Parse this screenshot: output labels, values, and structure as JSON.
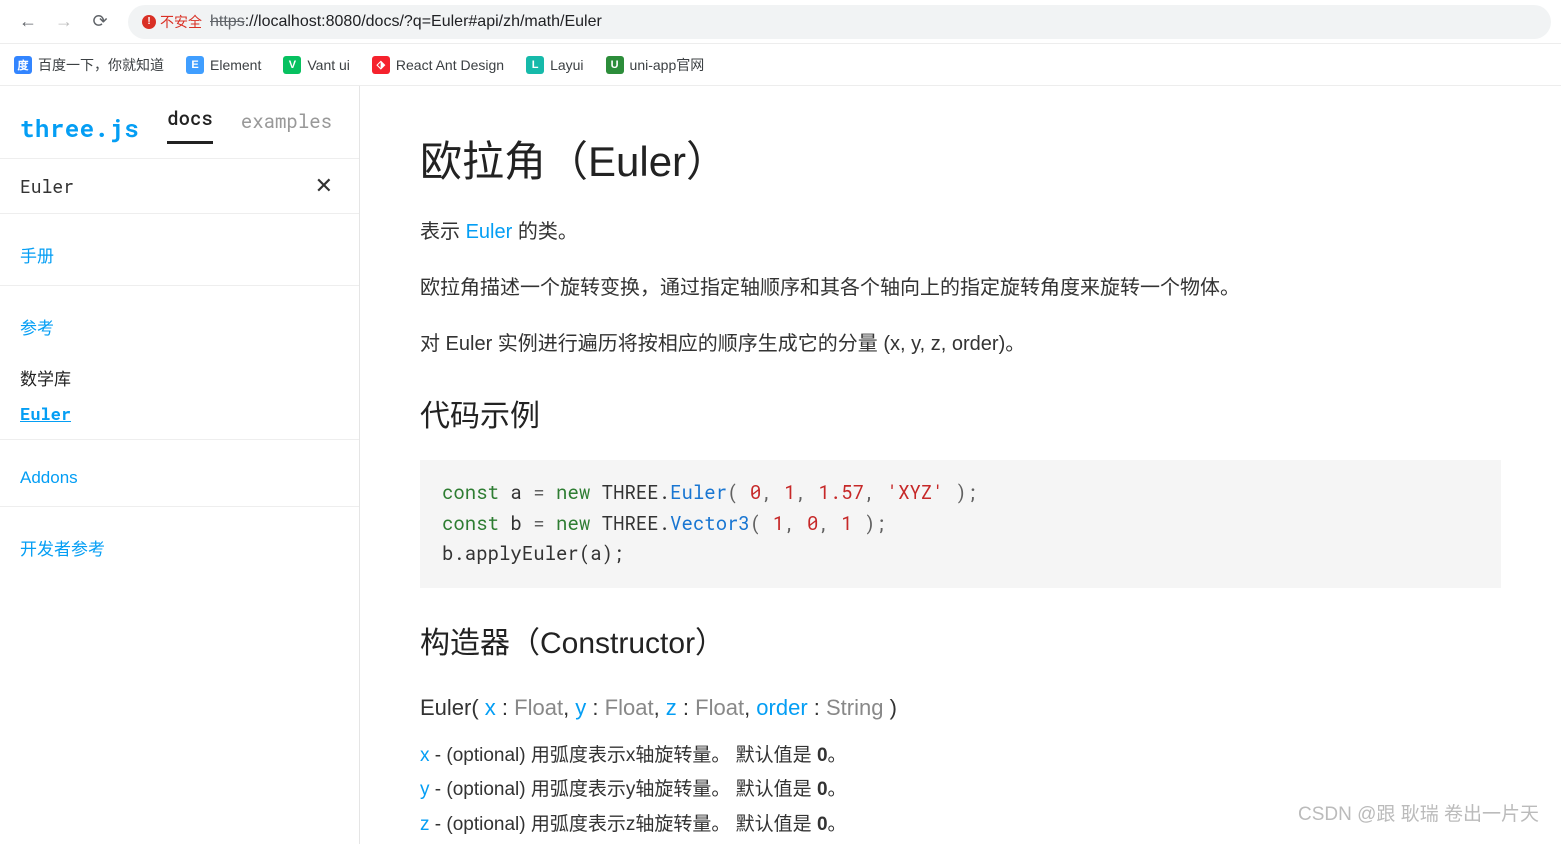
{
  "browser": {
    "security_label": "不安全",
    "url_scheme": "https",
    "url_rest": "://localhost:8080/docs/?q=Euler#api/zh/math/Euler"
  },
  "bookmarks": [
    {
      "label": "百度一下，你就知道",
      "icon_bg": "#3385ff",
      "icon_text": "度"
    },
    {
      "label": "Element",
      "icon_bg": "#409eff",
      "icon_text": "E"
    },
    {
      "label": "Vant ui",
      "icon_bg": "#07c160",
      "icon_text": "V"
    },
    {
      "label": "React Ant Design",
      "icon_bg": "#f5222d",
      "icon_text": "⬗"
    },
    {
      "label": "Layui",
      "icon_bg": "#16baaa",
      "icon_text": "L"
    },
    {
      "label": "uni-app官网",
      "icon_bg": "#2c8d3a",
      "icon_text": "U"
    }
  ],
  "sidebar": {
    "logo": "three.js",
    "tabs": {
      "docs": "docs",
      "examples": "examples"
    },
    "search_value": "Euler",
    "sections": {
      "manual": "手册",
      "reference": "参考",
      "math_lib": "数学库",
      "euler": "Euler",
      "addons": "Addons",
      "dev_ref": "开发者参考"
    }
  },
  "content": {
    "title": "欧拉角（Euler）",
    "intro_prefix": "表示 ",
    "intro_link": "Euler",
    "intro_suffix": " 的类。",
    "p1": "欧拉角描述一个旋转变换，通过指定轴顺序和其各个轴向上的指定旋转角度来旋转一个物体。",
    "p2": "对 Euler 实例进行遍历将按相应的顺序生成它的分量 (x, y, z, order)。",
    "h_code": "代码示例",
    "code": {
      "l1": {
        "kw": "const",
        "v": " a ",
        "eq": "= ",
        "new": "new",
        "sp": " THREE.",
        "cls": "Euler",
        "open": "( ",
        "a0": "0",
        "c": ", ",
        "a1": "1",
        "a2": "1.57",
        "str": "'XYZ'",
        "close": " );"
      },
      "l2": {
        "kw": "const",
        "v": " b ",
        "eq": "= ",
        "new": "new",
        "sp": " THREE.",
        "cls": "Vector3",
        "open": "( ",
        "a0": "1",
        "c": ", ",
        "a1": "0",
        "a2": "1",
        "close": " );"
      },
      "l3": "b.applyEuler(a);"
    },
    "h_ctor": "构造器（Constructor）",
    "sig": {
      "name": "Euler",
      "p": [
        {
          "n": "x",
          "t": "Float"
        },
        {
          "n": "y",
          "t": "Float"
        },
        {
          "n": "z",
          "t": "Float"
        },
        {
          "n": "order",
          "t": "String"
        }
      ]
    },
    "params": [
      {
        "n": "x",
        "desc": " - (optional) 用弧度表示x轴旋转量。 默认值是 ",
        "def": "0",
        "end": "。"
      },
      {
        "n": "y",
        "desc": " - (optional) 用弧度表示y轴旋转量。 默认值是 ",
        "def": "0",
        "end": "。"
      },
      {
        "n": "z",
        "desc": " - (optional) 用弧度表示z轴旋转量。 默认值是 ",
        "def": "0",
        "end": "。"
      }
    ]
  },
  "watermark": "CSDN @跟 耿瑞 卷出一片天"
}
